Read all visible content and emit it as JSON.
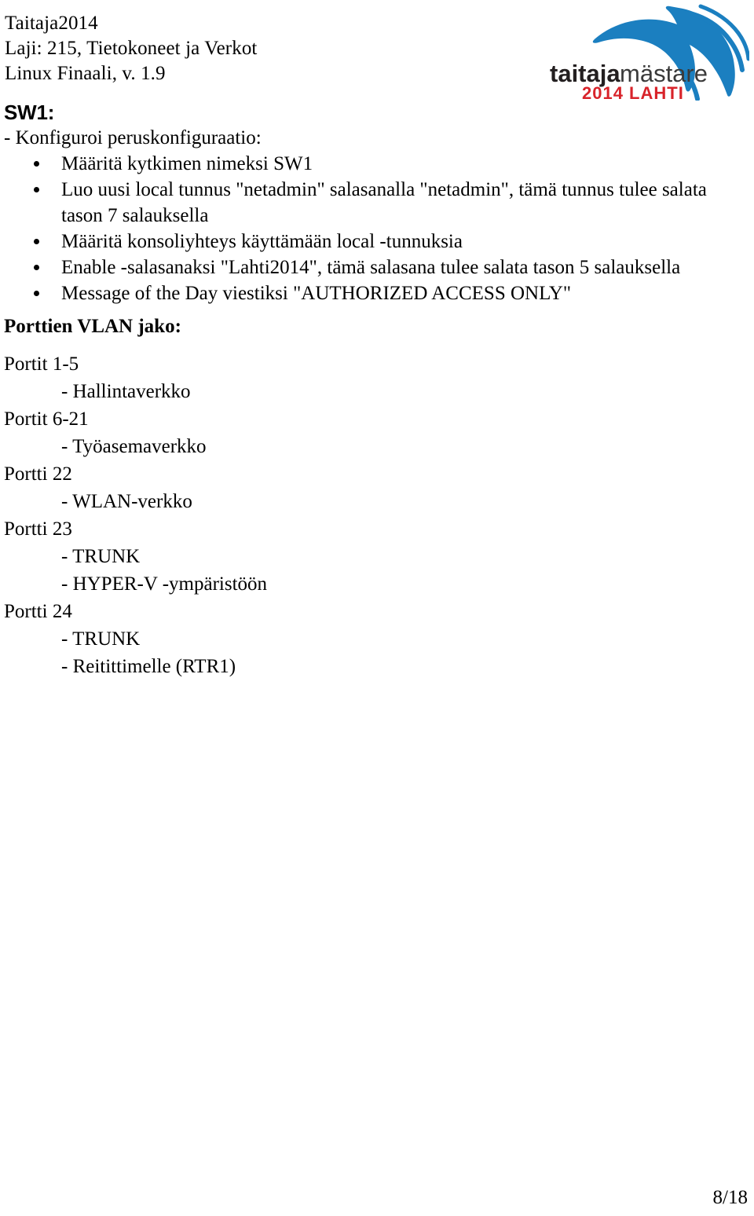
{
  "header": {
    "lines": [
      "Taitaja2014",
      "Laji: 215, Tietokoneet ja Verkot",
      "Linux Finaali, v. 1.9"
    ]
  },
  "logo": {
    "wordmark_bold": "taitaja",
    "wordmark_light": "mästare",
    "subtitle": "2014 LAHTI",
    "blue": "#1b7fc0",
    "red": "#d8232a",
    "dark": "#231f20"
  },
  "section": {
    "heading": "SW1:",
    "intro": "- Konfiguroi peruskonfiguraatio:",
    "bullets": [
      "Määritä kytkimen nimeksi SW1",
      "Luo uusi local tunnus \"netadmin\" salasanalla \"netadmin\", tämä tunnus tulee salata tason 7 salauksella",
      "Määritä konsoliyhteys käyttämään local -tunnuksia",
      "Enable -salasanaksi \"Lahti2014\", tämä salasana tulee salata tason 5 salauksella",
      "Message of the Day viestiksi \"AUTHORIZED ACCESS ONLY\""
    ]
  },
  "vlan": {
    "heading": "Porttien VLAN jako:",
    "entries": [
      {
        "port": "Portit 1-5",
        "subs": [
          "- Hallintaverkko"
        ]
      },
      {
        "port": "Portit 6-21",
        "subs": [
          "- Työasemaverkko"
        ]
      },
      {
        "port": "Portti 22",
        "subs": [
          "- WLAN-verkko"
        ]
      },
      {
        "port": "Portti 23",
        "subs": [
          "- TRUNK",
          "- HYPER-V -ympäristöön"
        ]
      },
      {
        "port": "Portti 24",
        "subs": [
          "- TRUNK",
          "- Reitittimelle (RTR1)"
        ]
      }
    ]
  },
  "footer": {
    "page_number": "8/18"
  }
}
